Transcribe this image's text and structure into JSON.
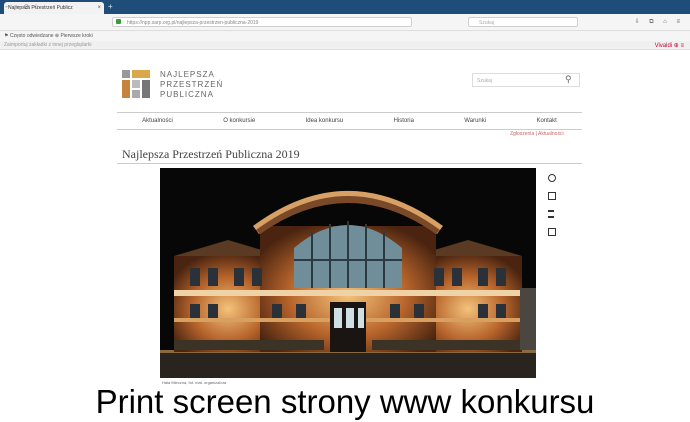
{
  "browser": {
    "tab_title": "Najlepsza Przestrzeń Publicz",
    "tab_close": "×",
    "new_tab": "+",
    "nav_buttons": [
      "←",
      "→",
      "⟳",
      "⌂"
    ],
    "url": "https://npp.sarp.org.pl/najlepsza-przestrzen-publiczna-2019",
    "search_placeholder": "Szukaj",
    "bookmarks": "⚑ Często odwiedzane   ⊕ Pierwsze kroki",
    "infobar": "Zaimportuj zakładki z innej przeglądarki",
    "toolbar_right": "⇩ ⧉ ⌂ ≡",
    "vivaldi": "Vivaldi ⊕ ≡"
  },
  "site": {
    "logo_lines": [
      "NAJLEPSZA",
      "PRZESTRZEŃ",
      "PUBLICZNA"
    ],
    "search_placeholder": "Szukaj",
    "search_icon": "⚲",
    "nav": [
      "Aktualności",
      "O konkursie",
      "Idea konkursu",
      "Historia",
      "Warunki",
      "Kontakt"
    ],
    "subnav": "Zgłoszenia | Aktualności",
    "page_title": "Najlepsza Przestrzeń Publiczna 2019",
    "image_caption": "Hala Mleczna, fot. mat. organizatora",
    "side_icons": [
      "facebook-icon",
      "share-icon",
      "print-icon",
      "mail-icon"
    ]
  },
  "overlay_caption": "Print screen strony www konkursu",
  "colors": {
    "tabbar": "#1f4d7a",
    "accent_red": "#cc0033",
    "hero_bg": "#0c0c0c",
    "building_glow": "#c9843c"
  }
}
